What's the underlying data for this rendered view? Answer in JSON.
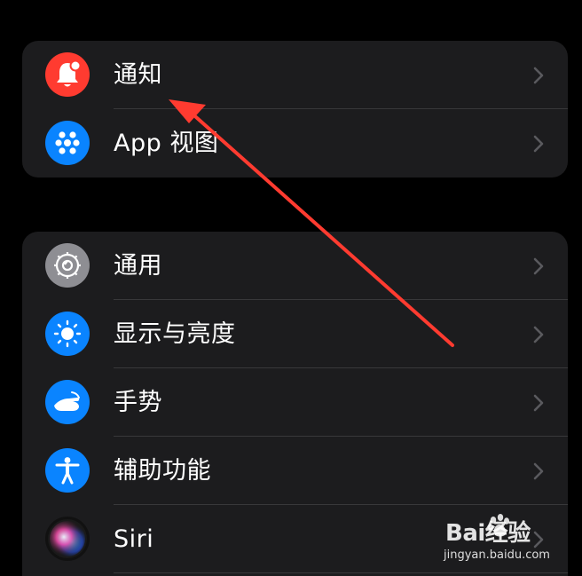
{
  "groups": [
    {
      "items": [
        {
          "label": "通知",
          "icon": "notification-bell-icon",
          "icon_color": "#ff3b30"
        },
        {
          "label": "App 视图",
          "icon": "app-grid-dots-icon",
          "icon_color": "#0a84ff"
        }
      ]
    },
    {
      "items": [
        {
          "label": "通用",
          "icon": "gear-icon",
          "icon_color": "#8e8e93"
        },
        {
          "label": "显示与亮度",
          "icon": "sun-brightness-icon",
          "icon_color": "#0a84ff"
        },
        {
          "label": "手势",
          "icon": "hand-gesture-icon",
          "icon_color": "#0a84ff"
        },
        {
          "label": "辅助功能",
          "icon": "accessibility-figure-icon",
          "icon_color": "#0a84ff"
        },
        {
          "label": "Siri",
          "icon": "siri-orb-icon",
          "icon_color": "#111111"
        }
      ]
    }
  ],
  "chevron_icon": "chevron-right-icon",
  "annotation": {
    "icon": "red-arrow-pointer",
    "color": "#ff3b30"
  },
  "watermark": {
    "logo_text": "Bai经验",
    "url_text": "jingyan.baidu.com"
  }
}
